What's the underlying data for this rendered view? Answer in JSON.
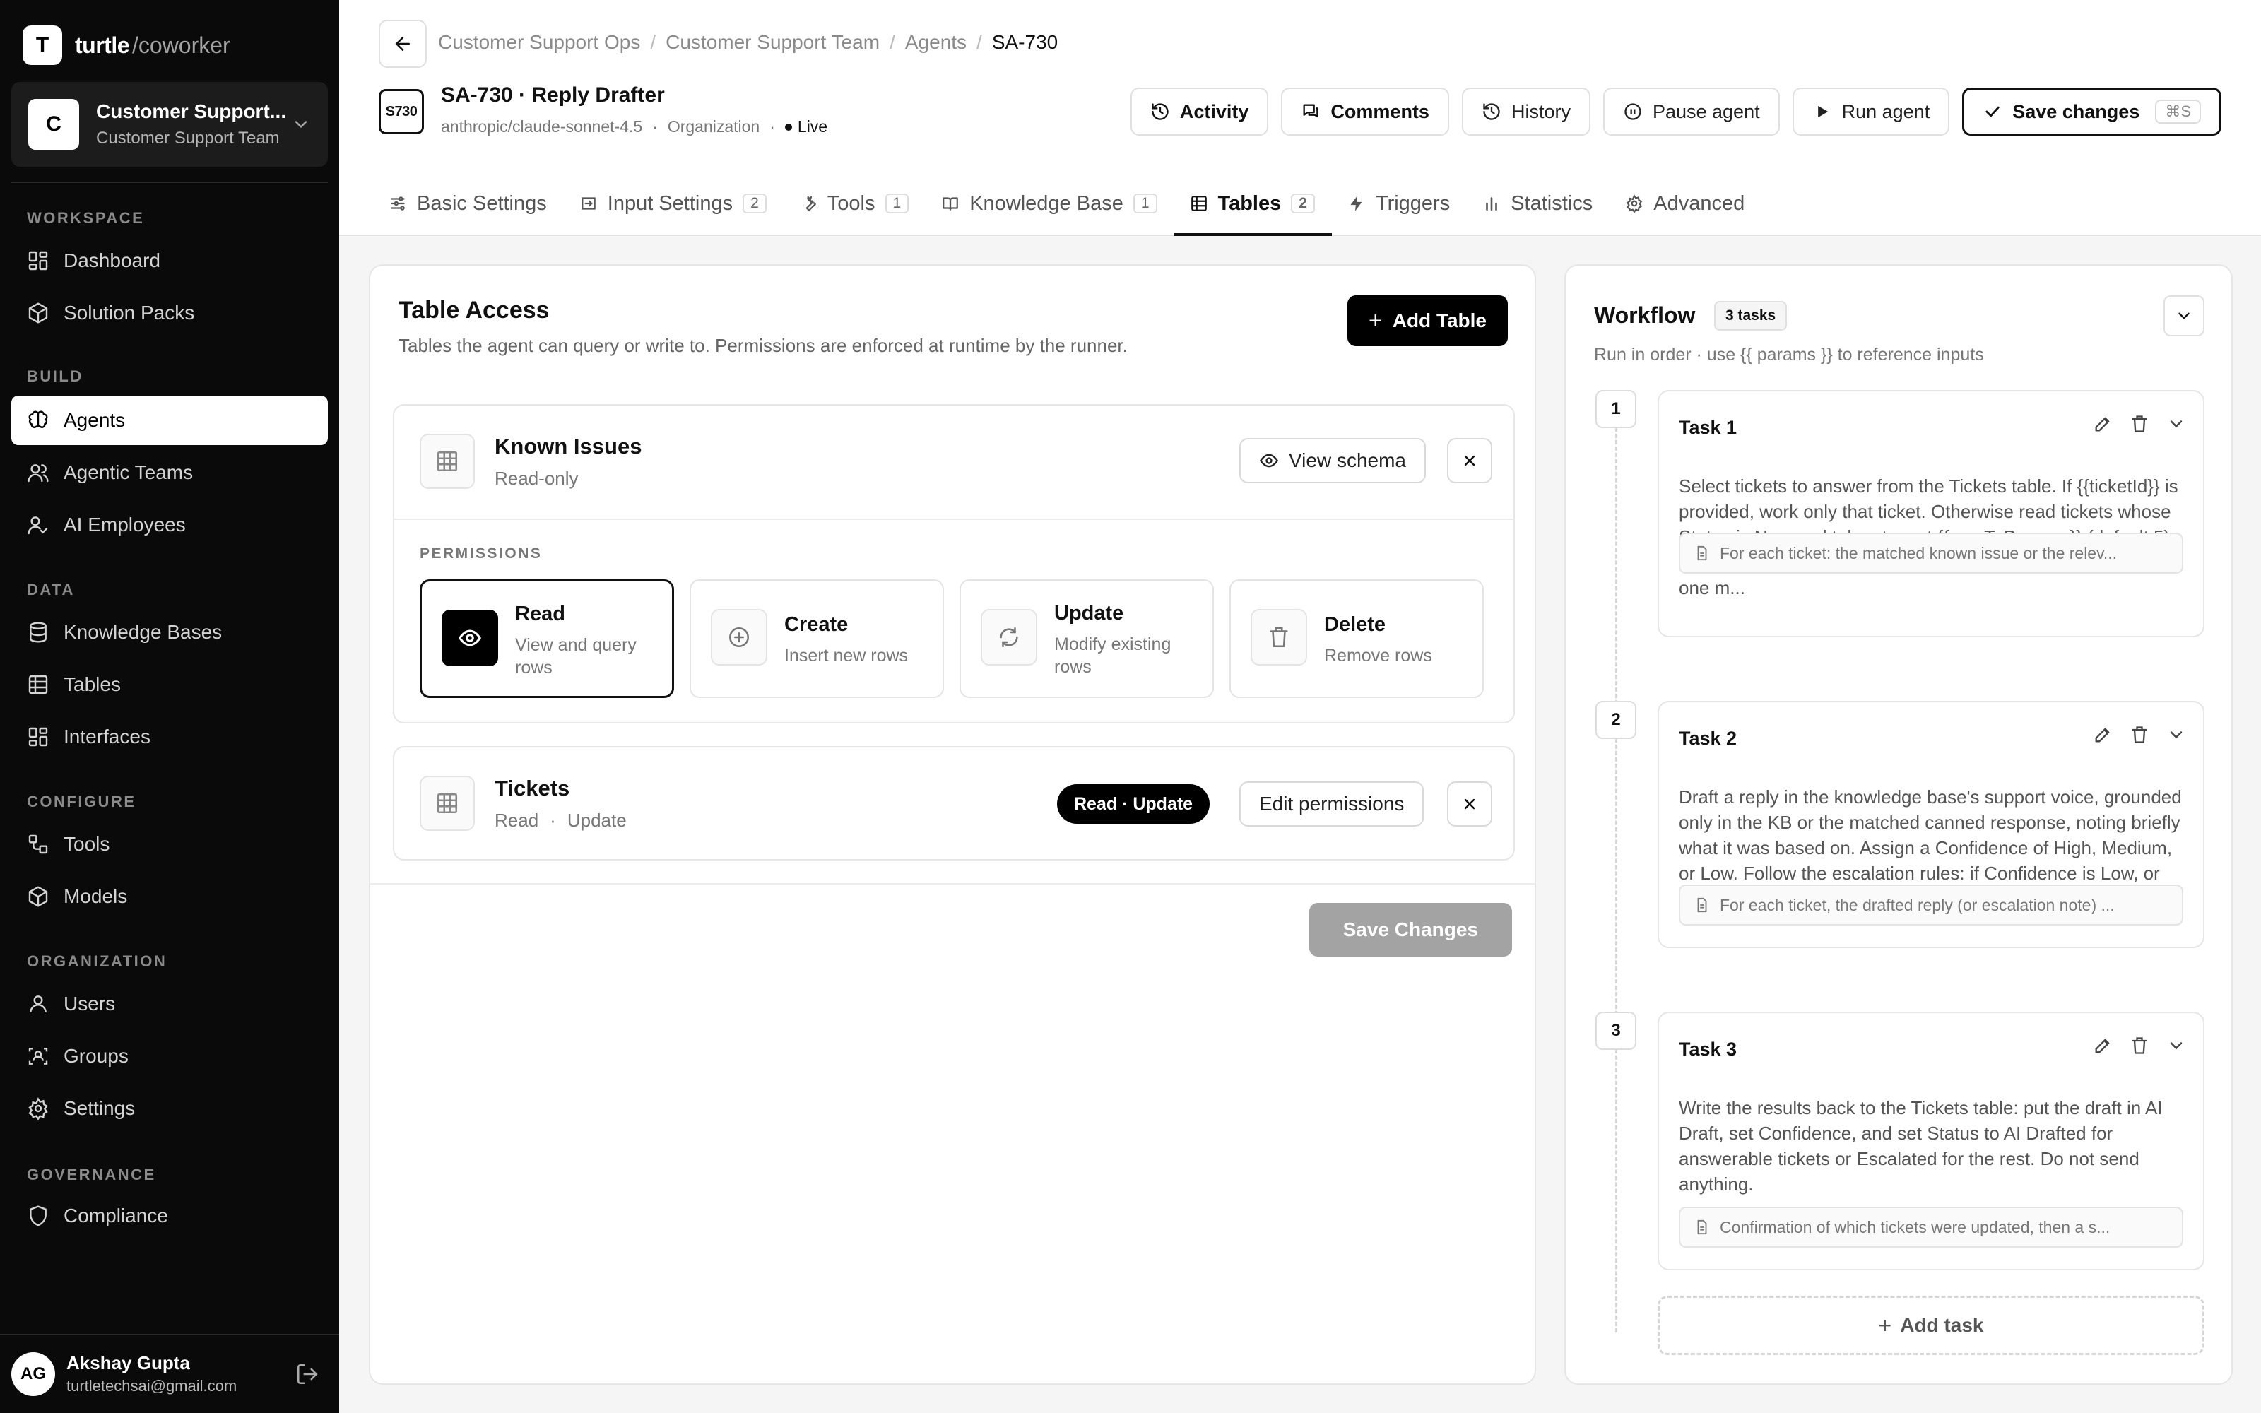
{
  "brand": {
    "mark": "T",
    "name": "turtle",
    "suffix": "/coworker"
  },
  "workspace": {
    "avatar": "C",
    "name": "Customer Support...",
    "team": "Customer Support Team"
  },
  "nav": {
    "workspace_label": "WORKSPACE",
    "build_label": "BUILD",
    "data_label": "DATA",
    "configure_label": "CONFIGURE",
    "organization_label": "ORGANIZATION",
    "governance_label": "GOVERNANCE",
    "dashboard": "Dashboard",
    "solution_packs": "Solution Packs",
    "agents": "Agents",
    "agentic_teams": "Agentic Teams",
    "ai_employees": "AI Employees",
    "knowledge_bases": "Knowledge Bases",
    "tables": "Tables",
    "interfaces": "Interfaces",
    "tools": "Tools",
    "models": "Models",
    "users": "Users",
    "groups": "Groups",
    "settings": "Settings",
    "compliance": "Compliance"
  },
  "user": {
    "initials": "AG",
    "name": "Akshay Gupta",
    "email": "turtletechsai@gmail.com"
  },
  "breadcrumb": [
    "Customer Support Ops",
    "Customer Support Team",
    "Agents",
    "SA-730"
  ],
  "agent": {
    "badge": "S730",
    "title": "SA-730 · Reply Drafter",
    "model": "anthropic/claude-sonnet-4.5",
    "scope": "Organization",
    "status": "Live"
  },
  "actions": {
    "activity": "Activity",
    "comments": "Comments",
    "history": "History",
    "pause": "Pause agent",
    "run": "Run agent",
    "save": "Save changes",
    "save_shortcut": "⌘S"
  },
  "tabs": [
    {
      "label": "Basic Settings",
      "count": ""
    },
    {
      "label": "Input Settings",
      "count": "2"
    },
    {
      "label": "Tools",
      "count": "1"
    },
    {
      "label": "Knowledge Base",
      "count": "1"
    },
    {
      "label": "Tables",
      "count": "2"
    },
    {
      "label": "Triggers",
      "count": ""
    },
    {
      "label": "Statistics",
      "count": ""
    },
    {
      "label": "Advanced",
      "count": ""
    }
  ],
  "table_access": {
    "title": "Table Access",
    "description": "Tables the agent can query or write to. Permissions are enforced at runtime by the runner.",
    "add_button": "Add Table",
    "save_button": "Save Changes",
    "permissions_label": "PERMISSIONS",
    "tables": [
      {
        "name": "Known Issues",
        "access": "Read-only",
        "action": "View schema",
        "permissions": [
          {
            "title": "Read",
            "desc": "View and query rows",
            "selected": true
          },
          {
            "title": "Create",
            "desc": "Insert new rows",
            "selected": false
          },
          {
            "title": "Update",
            "desc": "Modify existing rows",
            "selected": false
          },
          {
            "title": "Delete",
            "desc": "Remove rows",
            "selected": false
          }
        ]
      },
      {
        "name": "Tickets",
        "access_parts": [
          "Read",
          "·",
          "Update"
        ],
        "pill": "Read · Update",
        "action": "Edit permissions"
      }
    ]
  },
  "workflow": {
    "title": "Workflow",
    "count": "3 tasks",
    "subtitle": "Run in order · use {{ params }} to reference inputs",
    "add_task": "Add task",
    "tasks": [
      {
        "num": "1",
        "title": "Task 1",
        "body": "Select tickets to answer from the Tickets table. If {{ticketId}} is provided, work only that ticket. Otherwise read tickets whose Status is New and take at most {{maxToProcess}} (default 5). For each, first check the Known Issues table for a match; if one m...",
        "output": "For each ticket: the matched known issue or the relev..."
      },
      {
        "num": "2",
        "title": "Task 2",
        "body": "Draft a reply in the knowledge base's support voice, grounded only in the KB or the matched canned response, noting briefly what it was based on. Assign a Confidence of High, Medium, or Low. Follow the escalation rules: if Confidence is Low, or the ticket i...",
        "output": "For each ticket, the drafted reply (or escalation note) ..."
      },
      {
        "num": "3",
        "title": "Task 3",
        "body": "Write the results back to the Tickets table: put the draft in AI Draft, set Confidence, and set Status to AI Drafted for answerable tickets or Escalated for the rest. Do not send anything.",
        "output": "Confirmation of which tickets were updated, then a s..."
      }
    ]
  }
}
